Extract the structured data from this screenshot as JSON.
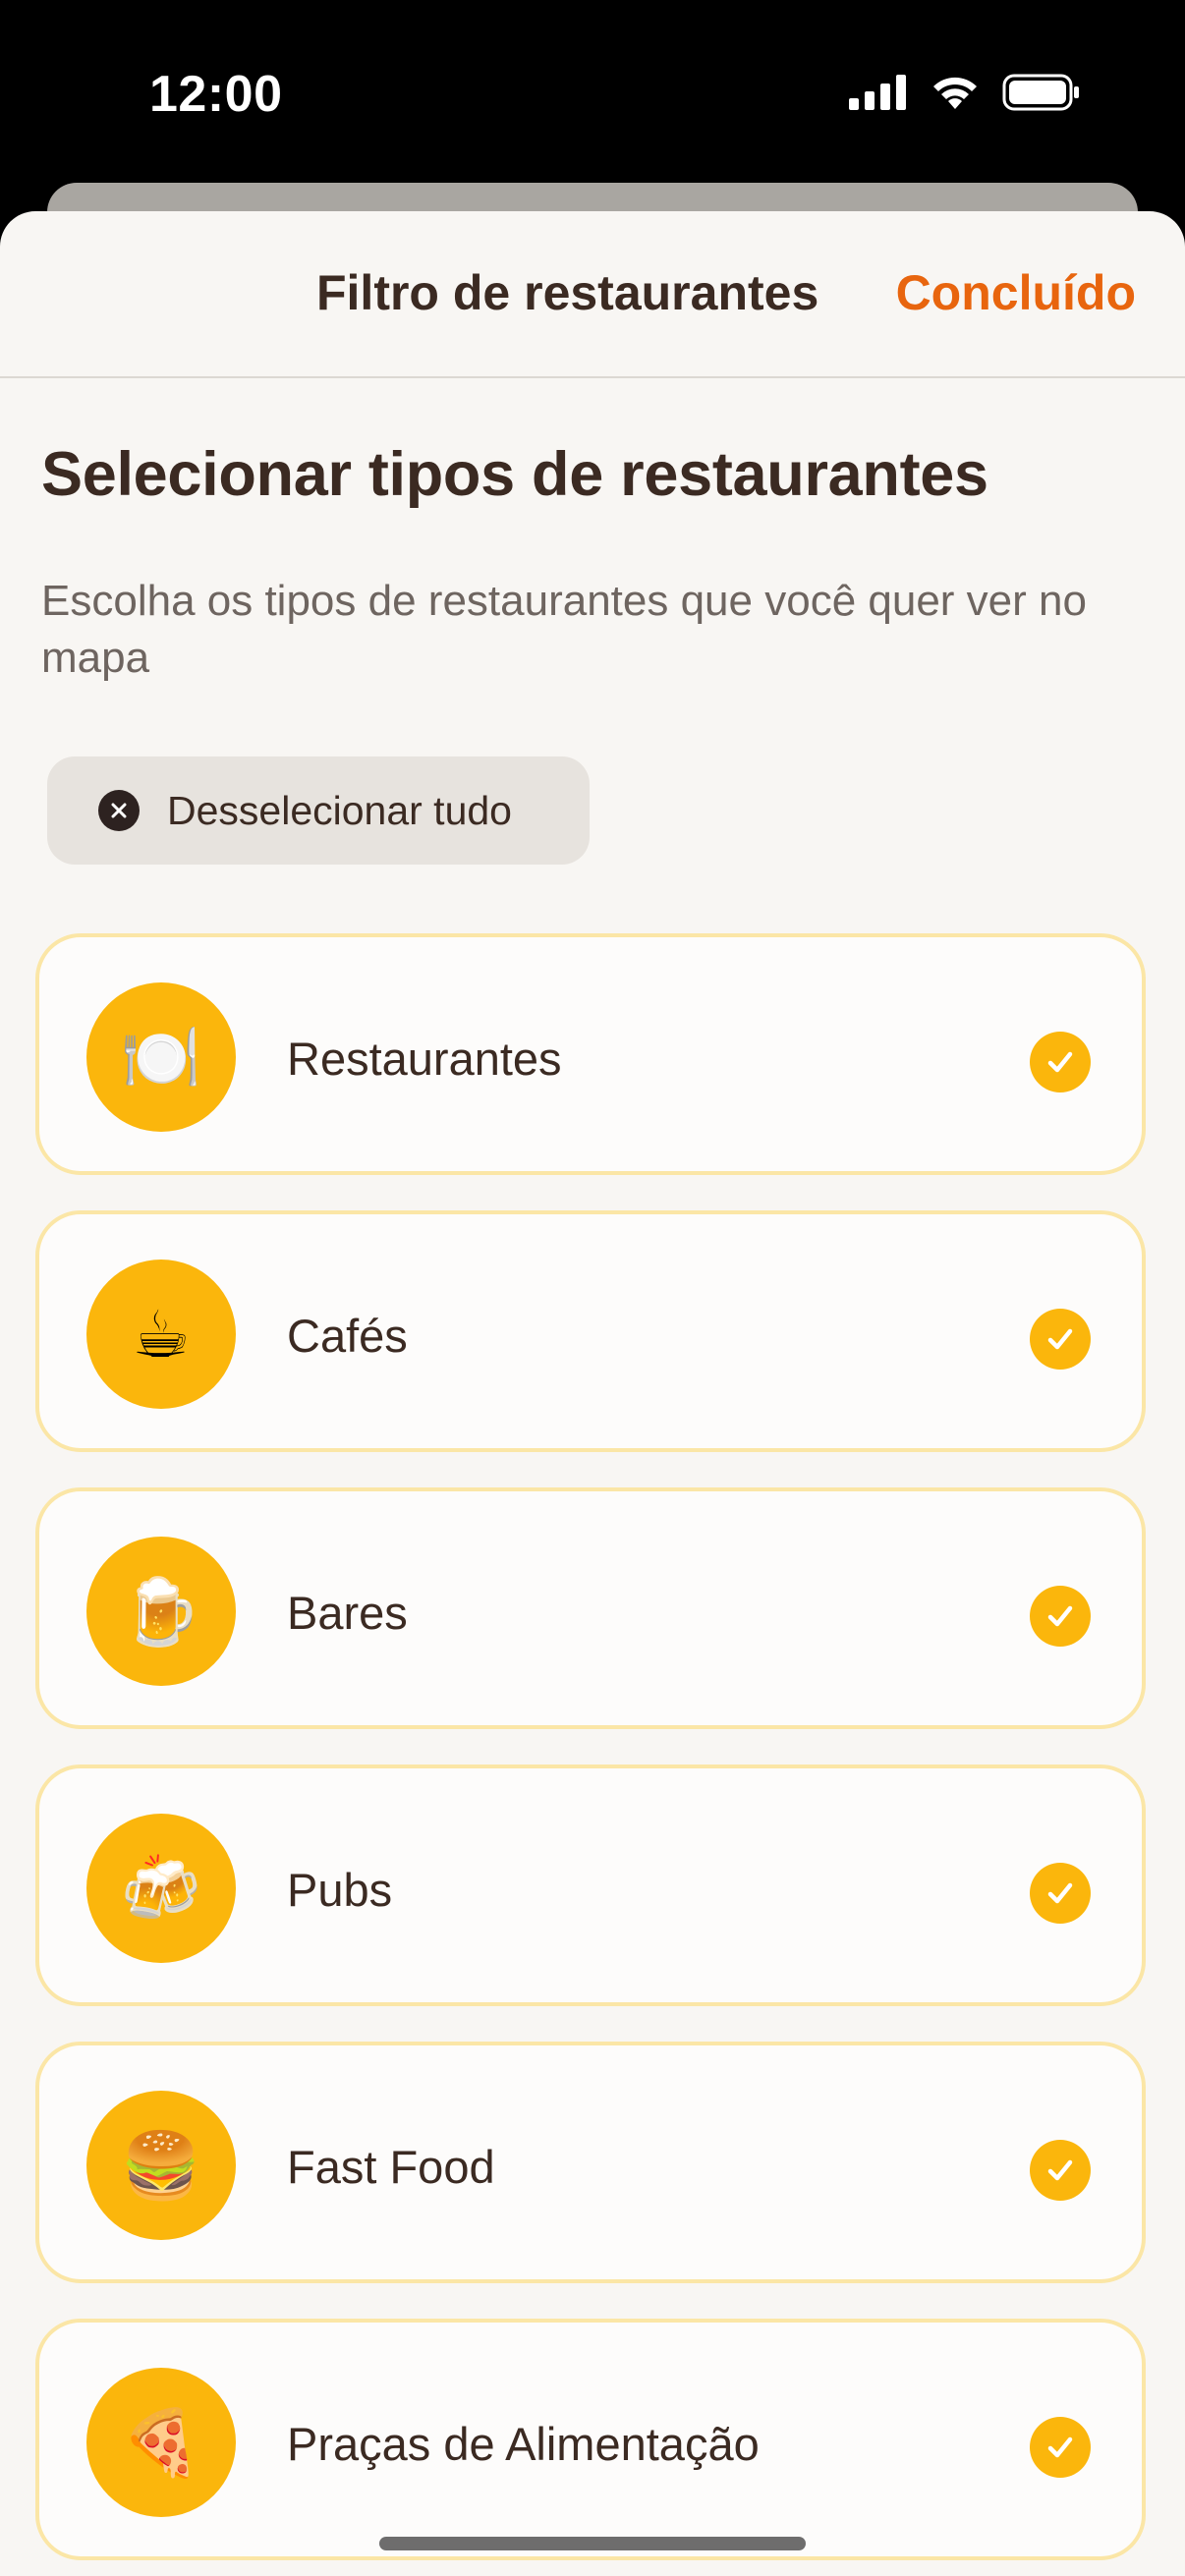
{
  "status_bar": {
    "time": "12:00",
    "icons": [
      "cellular-signal-icon",
      "wifi-icon",
      "battery-icon"
    ]
  },
  "nav": {
    "title": "Filtro de restaurantes",
    "done_label": "Concluído"
  },
  "content": {
    "heading": "Selecionar tipos de restaurantes",
    "subtitle": "Escolha os tipos de restaurantes que você quer ver no mapa",
    "deselect_all_label": "Desselecionar tudo"
  },
  "categories": [
    {
      "label": "Restaurantes",
      "emoji": "🍽️",
      "icon": "plate-cutlery-icon",
      "selected": true
    },
    {
      "label": "Cafés",
      "emoji": "☕",
      "icon": "coffee-cup-icon",
      "selected": true
    },
    {
      "label": "Bares",
      "emoji": "🍺",
      "icon": "beer-mug-icon",
      "selected": true
    },
    {
      "label": "Pubs",
      "emoji": "🍻",
      "icon": "clinking-beers-icon",
      "selected": true
    },
    {
      "label": "Fast Food",
      "emoji": "🍔",
      "icon": "burger-icon",
      "selected": true
    },
    {
      "label": "Praças de Alimentação",
      "emoji": "🍕",
      "icon": "pizza-icon",
      "selected": true
    }
  ],
  "colors": {
    "accent": "#e8650e",
    "selection": "#fbb60c",
    "card_border": "#fbe6a6",
    "background": "#f8f6f3",
    "text": "#3b2a22"
  }
}
